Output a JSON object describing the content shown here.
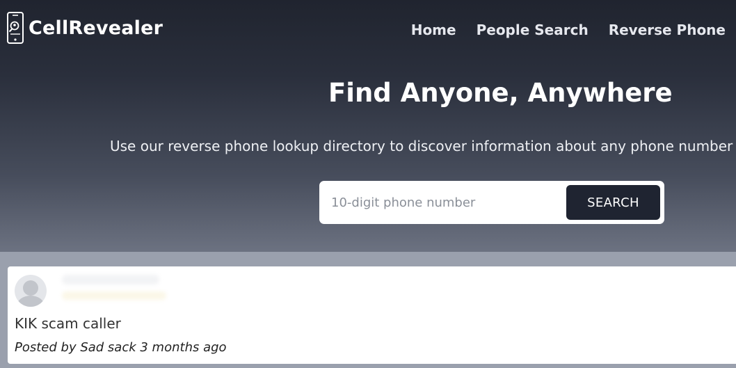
{
  "header": {
    "logo_text": "CellRevealer",
    "logo_icon": "phone-search-icon",
    "nav": [
      {
        "label": "Home"
      },
      {
        "label": "People Search"
      },
      {
        "label": "Reverse Phone"
      }
    ]
  },
  "hero": {
    "title": "Find Anyone, Anywhere",
    "subtitle": "Use our reverse phone lookup directory to discover information about any phone number i",
    "search": {
      "placeholder": "10-digit phone number",
      "value": "",
      "button_label": "SEARCH"
    }
  },
  "comment": {
    "avatar_icon": "user-avatar-icon",
    "text": "KIK scam caller",
    "posted": "Posted by Sad sack 3 months ago"
  },
  "colors": {
    "dark": "#1f2431",
    "hero_bottom": "#6c7281",
    "page_bg": "#9aa0ad"
  }
}
